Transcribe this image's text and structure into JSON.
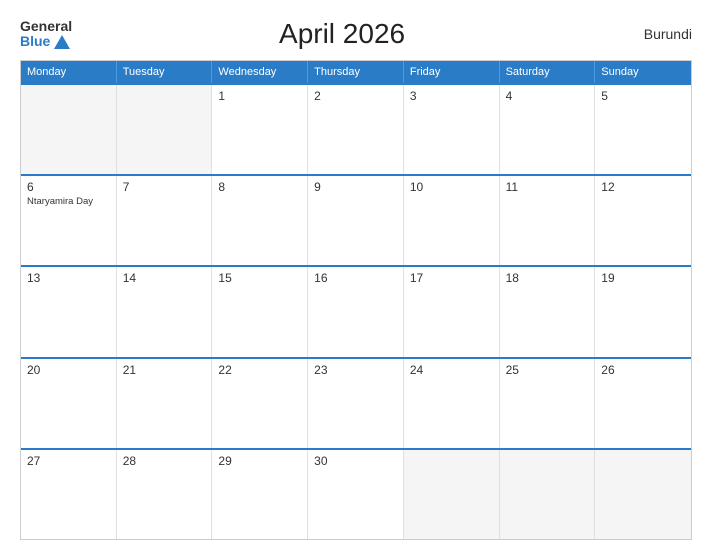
{
  "header": {
    "logo_general": "General",
    "logo_blue": "Blue",
    "title": "April 2026",
    "country": "Burundi"
  },
  "days_of_week": [
    "Monday",
    "Tuesday",
    "Wednesday",
    "Thursday",
    "Friday",
    "Saturday",
    "Sunday"
  ],
  "weeks": [
    [
      {
        "num": "",
        "empty": true
      },
      {
        "num": "",
        "empty": true
      },
      {
        "num": "1",
        "empty": false
      },
      {
        "num": "2",
        "empty": false
      },
      {
        "num": "3",
        "empty": false
      },
      {
        "num": "4",
        "empty": false
      },
      {
        "num": "5",
        "empty": false
      }
    ],
    [
      {
        "num": "6",
        "empty": false,
        "event": "Ntaryamira Day"
      },
      {
        "num": "7",
        "empty": false
      },
      {
        "num": "8",
        "empty": false
      },
      {
        "num": "9",
        "empty": false
      },
      {
        "num": "10",
        "empty": false
      },
      {
        "num": "11",
        "empty": false
      },
      {
        "num": "12",
        "empty": false
      }
    ],
    [
      {
        "num": "13",
        "empty": false
      },
      {
        "num": "14",
        "empty": false
      },
      {
        "num": "15",
        "empty": false
      },
      {
        "num": "16",
        "empty": false
      },
      {
        "num": "17",
        "empty": false
      },
      {
        "num": "18",
        "empty": false
      },
      {
        "num": "19",
        "empty": false
      }
    ],
    [
      {
        "num": "20",
        "empty": false
      },
      {
        "num": "21",
        "empty": false
      },
      {
        "num": "22",
        "empty": false
      },
      {
        "num": "23",
        "empty": false
      },
      {
        "num": "24",
        "empty": false
      },
      {
        "num": "25",
        "empty": false
      },
      {
        "num": "26",
        "empty": false
      }
    ],
    [
      {
        "num": "27",
        "empty": false
      },
      {
        "num": "28",
        "empty": false
      },
      {
        "num": "29",
        "empty": false
      },
      {
        "num": "30",
        "empty": false
      },
      {
        "num": "",
        "empty": true
      },
      {
        "num": "",
        "empty": true
      },
      {
        "num": "",
        "empty": true
      }
    ]
  ]
}
